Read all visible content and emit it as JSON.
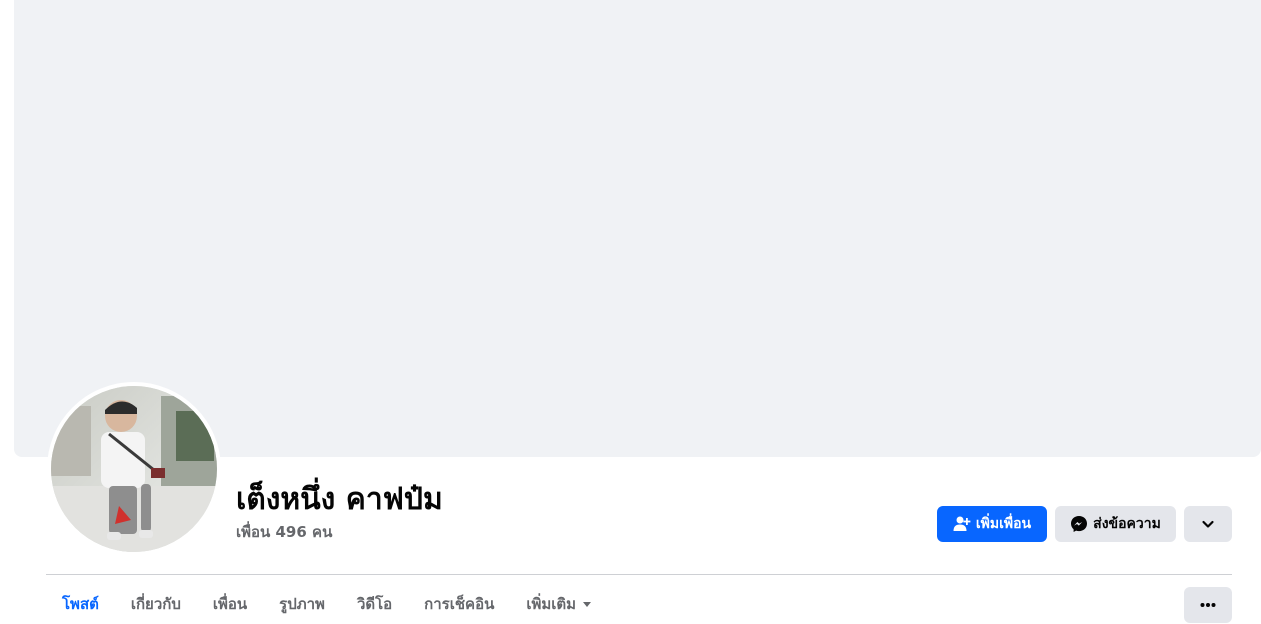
{
  "profile": {
    "name": "เต็งหนึ่ง คาฟป๋ม",
    "friends_count": "เพื่อน 496 คน"
  },
  "actions": {
    "add_friend_label": "เพิ่มเพื่อน",
    "add_friend_icon": "person-add-icon",
    "message_label": "ส่งข้อความ",
    "message_icon": "messenger-icon",
    "more_icon": "chevron-down-icon"
  },
  "tabs": [
    {
      "label": "โพสต์",
      "active": true
    },
    {
      "label": "เกี่ยวกับ"
    },
    {
      "label": "เพื่อน"
    },
    {
      "label": "รูปภาพ"
    },
    {
      "label": "วิดีโอ"
    },
    {
      "label": "การเช็คอิน"
    },
    {
      "label": "เพิ่มเติม",
      "icon": "caret-down-icon"
    }
  ],
  "tab_actions": {
    "more_icon": "ellipsis-icon"
  },
  "colors": {
    "accent": "#0866ff",
    "cover_bg": "#f0f2f5",
    "button_gray": "#e4e6eb",
    "secondary_text": "#65676b"
  }
}
